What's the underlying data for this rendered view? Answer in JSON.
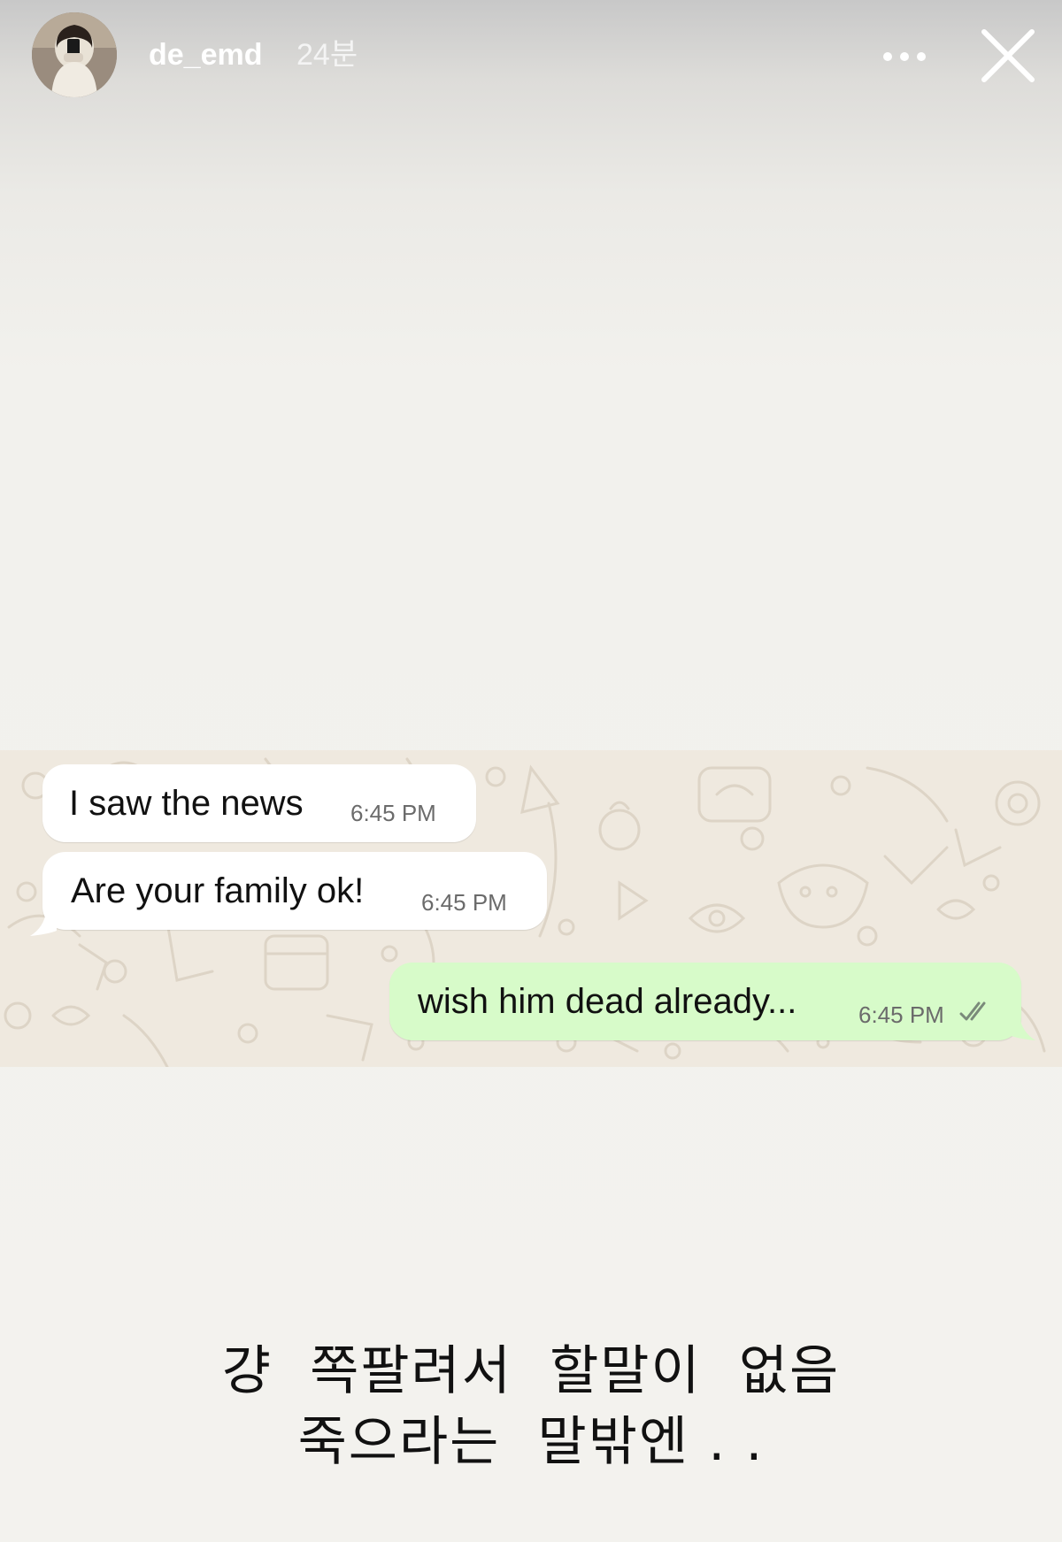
{
  "story": {
    "username": "de_emd",
    "time_ago": "24분"
  },
  "icons": {
    "more": "more-horizontal-icon",
    "close": "close-icon",
    "read_receipt": "double-check-icon"
  },
  "colors": {
    "incoming_bubble": "#ffffff",
    "outgoing_bubble": "#d7fbc9",
    "chat_background": "#efe9df",
    "story_background": "#f3f2ee"
  },
  "chat": {
    "messages": [
      {
        "direction": "incoming",
        "text": "I saw the news",
        "time": "6:45 PM"
      },
      {
        "direction": "incoming",
        "text": "Are your family ok!",
        "time": "6:45 PM"
      },
      {
        "direction": "outgoing",
        "text": "wish him dead already...",
        "time": "6:45 PM"
      }
    ]
  },
  "caption": {
    "line1": "걍  쪽팔려서  할말이  없음",
    "line2": "죽으라는  말밖엔 . ."
  }
}
